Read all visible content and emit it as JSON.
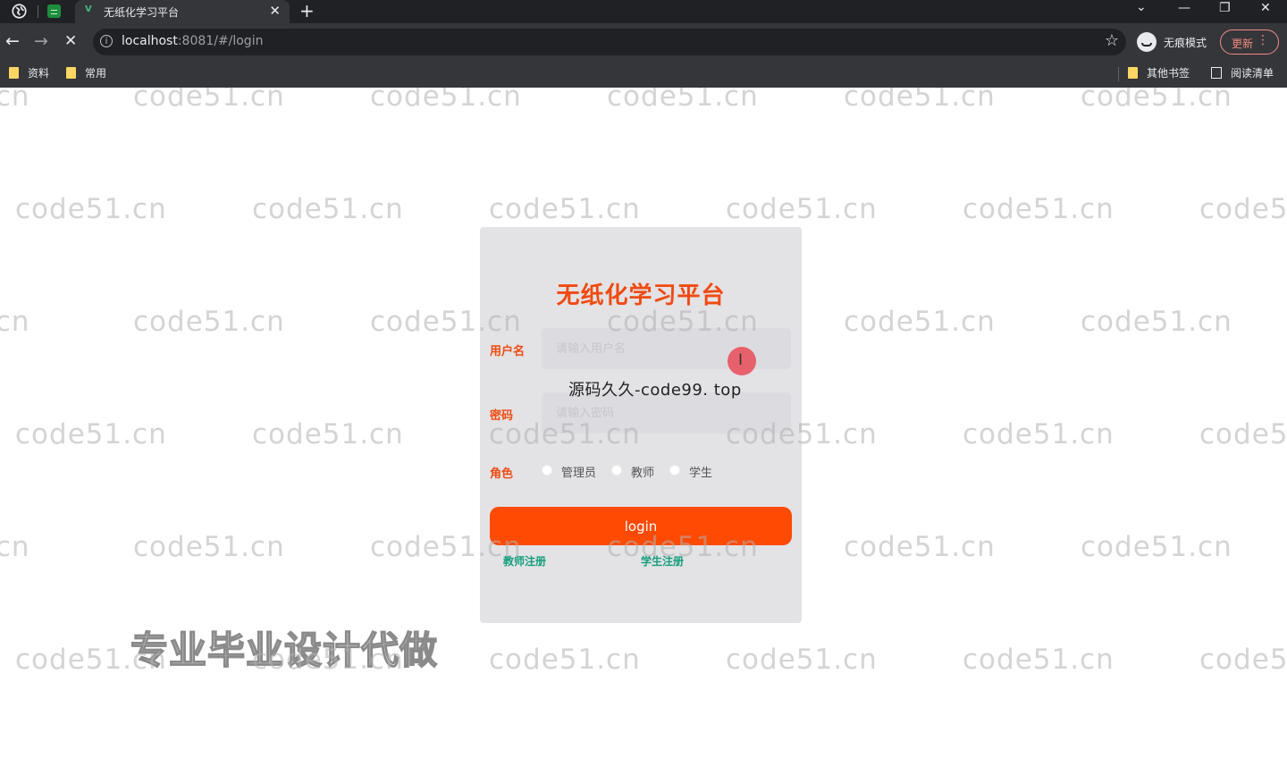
{
  "browser": {
    "tab_title": "无纸化学习平台",
    "tab_favicon": "V",
    "new_tab": "+",
    "url_host": "localhost",
    "url_rest": ":8081/#/login",
    "incognito_label": "无痕模式",
    "update_label": "更新",
    "bookmarks": [
      "资料",
      "常用"
    ],
    "other_bookmarks": "其他书签",
    "reading_list": "阅读清单"
  },
  "login": {
    "title": "无纸化学习平台",
    "username_label": "用户名",
    "username_placeholder": "请输入用户名",
    "password_label": "密码",
    "password_placeholder": "请输入密码",
    "role_label": "角色",
    "roles": [
      "管理员",
      "教师",
      "学生"
    ],
    "submit_label": "login",
    "register_teacher": "教师注册",
    "register_student": "学生注册"
  },
  "overlays": {
    "source_text": "源码久久-code99. top",
    "ad_text": "专业毕业设计代做",
    "watermark": "code51.cn"
  },
  "colors": {
    "accent": "#f04a10",
    "button": "#ff4a03",
    "link": "#139e7c",
    "card_bg": "#e3e2e5"
  }
}
